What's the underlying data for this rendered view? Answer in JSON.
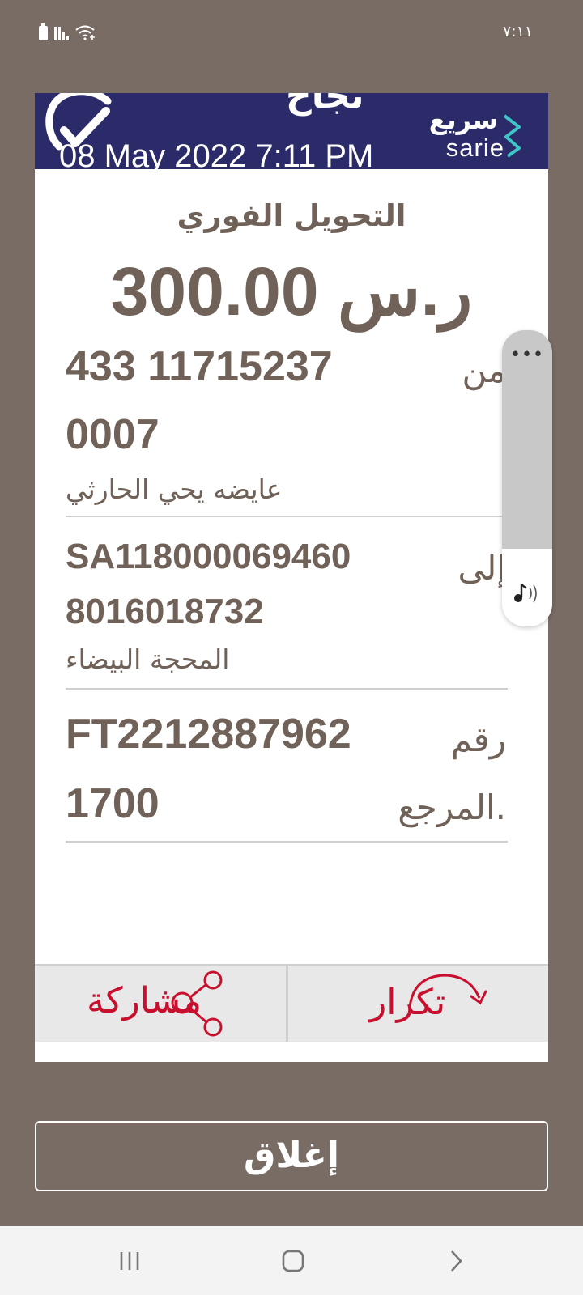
{
  "status_bar": {
    "time": "٧:١١",
    "icons": [
      "battery-icon",
      "signal-icon",
      "wifi-icon"
    ]
  },
  "banner": {
    "title": "نجاح",
    "date": "08 May 2022 7:11 PM",
    "brand_ar": "سريع",
    "brand_en": "sarie",
    "background": "#2b2b6a"
  },
  "transfer": {
    "type": "التحويل الفوري",
    "amount": "300.00 ر.س",
    "from_label": "من",
    "from_account_line1": "433  11715237",
    "from_account_line2": "0007",
    "from_name": "عايضه يحي الحارثي",
    "to_label": "إلى",
    "to_iban_line1": "SA118000069460",
    "to_iban_line2": "8016018732",
    "to_name": "المحجة البيضاء",
    "ref_label_line1": "رقم",
    "ref_label_line2": "المرجع.",
    "ref_value_line1": "FT2212887962",
    "ref_value_line2": "1700"
  },
  "actions": {
    "share_label": "مشاركة",
    "repeat_label": "تكرار",
    "accent": "#c8102e"
  },
  "side_panel": {
    "more_label": "•••",
    "icons": [
      "more-icon",
      "music-note-icon"
    ]
  },
  "close_label": "إغلاق",
  "navigation": {
    "icons": [
      "recent-apps-icon",
      "home-icon",
      "back-icon"
    ]
  },
  "colors": {
    "background": "#786c64",
    "text": "#706258"
  }
}
